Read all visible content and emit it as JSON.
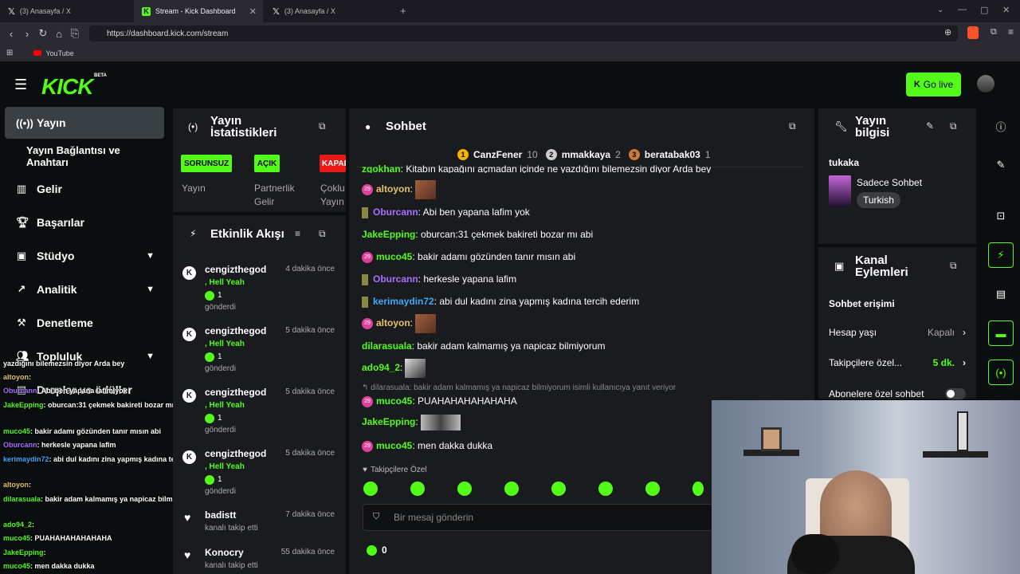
{
  "browser": {
    "tabs": [
      {
        "label": "(3) Anasayfa / X"
      },
      {
        "label": "Stream - Kick Dashboard"
      },
      {
        "label": "(3) Anasayfa / X"
      }
    ],
    "url": "https://dashboard.kick.com/stream",
    "bookmark": "YouTube"
  },
  "header": {
    "logo": "KICK",
    "beta": "BETA",
    "go_live": "Go live"
  },
  "sidebar": {
    "items": [
      {
        "label": "Yayın"
      },
      {
        "label": "Yayın Bağlantısı ve Anahtarı"
      },
      {
        "label": "Gelir"
      },
      {
        "label": "Başarılar"
      },
      {
        "label": "Stüdyo"
      },
      {
        "label": "Analitik"
      },
      {
        "label": "Denetleme"
      },
      {
        "label": "Topluluk"
      },
      {
        "label": "Droplar ve ödüller"
      }
    ]
  },
  "overlay": {
    "lines": [
      {
        "user": "",
        "text": "yazdığını bilemezsin diyor Arda bey"
      },
      {
        "user": "altoyon",
        "text": ": "
      },
      {
        "user": "Oburcann",
        "text": ": Abi ben yapana lafim yok"
      },
      {
        "user": "JakeEpping",
        "text": ": oburcan:31 çekmek bakireti bozar mı abi"
      },
      {
        "user": "muco45",
        "text": ": bakir adamı gözünden tanır mısın abi"
      },
      {
        "user": "Oburcann",
        "text": ": herkesle yapana lafim"
      },
      {
        "user": "kerimaydin72",
        "text": ": abi dul kadını zina yapmış kadına tercih ederim"
      },
      {
        "user": "altoyon",
        "text": ": "
      },
      {
        "user": "dilarasuala",
        "text": ": bakir adam kalmamış ya napicaz bilmiyorum"
      },
      {
        "user": "ado94_2",
        "text": ": "
      },
      {
        "user": "muco45",
        "text": ": PUAHAHAHAHAHAHA"
      },
      {
        "user": "JakeEpping",
        "text": ": "
      },
      {
        "user": "muco45",
        "text": ": men dakka dukka"
      }
    ]
  },
  "stats": {
    "title": "Yayın İstatistikleri",
    "badges": [
      {
        "label": "SORUNSUZ",
        "color": "#53fc18"
      },
      {
        "label": "AÇIK",
        "color": "#53fc18"
      },
      {
        "label": "KAPALI",
        "color": "#e91916"
      }
    ],
    "labels": [
      "Yayın",
      "Partnerlik Gelir",
      "Çoklu Yayın"
    ]
  },
  "events": {
    "title": "Etkinlik Akışı",
    "items": [
      {
        "user": "cengizthegod",
        "time": "4 dakika önce",
        "msg": ", Hell Yeah",
        "count": "1",
        "sub": "gönderdi"
      },
      {
        "user": "cengizthegod",
        "time": "5 dakika önce",
        "msg": ", Hell Yeah",
        "count": "1",
        "sub": "gönderdi"
      },
      {
        "user": "cengizthegod",
        "time": "5 dakika önce",
        "msg": ", Hell Yeah",
        "count": "1",
        "sub": "gönderdi"
      },
      {
        "user": "cengizthegod",
        "time": "5 dakika önce",
        "msg": ", Hell Yeah",
        "count": "1",
        "sub": "gönderdi"
      },
      {
        "user": "badistt",
        "time": "7 dakika önce",
        "msg": "",
        "count": "",
        "sub": "kanalı takip etti"
      },
      {
        "user": "Konocry",
        "time": "55 dakika önce",
        "msg": "",
        "count": "",
        "sub": "kanalı takip etti"
      }
    ]
  },
  "chat": {
    "title": "Sohbet",
    "leaders": [
      {
        "rank": "1",
        "name": "CanzFener",
        "count": "10"
      },
      {
        "rank": "2",
        "name": "mmakkaya",
        "count": "2"
      },
      {
        "rank": "3",
        "name": "beratabak03",
        "count": "1"
      }
    ],
    "messages": [
      {
        "user": "zgokhan",
        "color": "#53fc18",
        "text": ": Kitabın kapağını açmadan içinde ne yazdığını bilemezsin diyor Arda bey",
        "badge": "",
        "pic": false
      },
      {
        "user": "altoyon",
        "color": "#e6c466",
        "text": ":",
        "badge": "29",
        "pic": true
      },
      {
        "user": "Oburcann",
        "color": "#a970ff",
        "text": ": Abi ben yapana lafim yok",
        "badge": "",
        "pic": false
      },
      {
        "user": "JakeEpping",
        "color": "#53fc18",
        "text": ": oburcan:31 çekmek bakireti bozar mı abi",
        "badge": "",
        "pic": false
      },
      {
        "user": "muco45",
        "color": "#53fc18",
        "text": ": bakir adamı gözünden tanır mısın abi",
        "badge": "29",
        "pic": false
      },
      {
        "user": "Oburcann",
        "color": "#a970ff",
        "text": ": herkesle yapana lafim",
        "badge": "",
        "pic": false
      },
      {
        "user": "kerimaydin72",
        "color": "#3fa9f5",
        "text": ": abi dul kadını zina yapmış kadına tercih ederim",
        "badge": "",
        "pic": false
      },
      {
        "user": "altoyon",
        "color": "#e6c466",
        "text": ":",
        "badge": "29",
        "pic": true
      },
      {
        "user": "dilarasuala",
        "color": "#53fc18",
        "text": ": bakir adam kalmamış ya napicaz bilmiyorum",
        "badge": "",
        "pic": false
      },
      {
        "user": "ado94_2",
        "color": "#53fc18",
        "text": ":",
        "badge": "",
        "pic": true
      }
    ],
    "reply_ref": "dilarasuala: bakir adam kalmamış ya napicaz bilmiyorum isimli kullanıcıya yanıt veriyor",
    "messages2": [
      {
        "user": "muco45",
        "color": "#53fc18",
        "text": ": PUAHAHAHAHAHAHA",
        "badge": "29",
        "pic": false
      },
      {
        "user": "JakeEpping",
        "color": "#53fc18",
        "text": ":",
        "badge": "",
        "pic": true
      },
      {
        "user": "muco45",
        "color": "#53fc18",
        "text": ": men dakka dukka",
        "badge": "29",
        "pic": false
      }
    ],
    "followers_only": "Takipçilere Özel",
    "input_placeholder": "Bir mesaj gönderin",
    "kick_count": "0"
  },
  "info": {
    "title": "Yayın bilgisi",
    "username": "tukaka",
    "category": "Sadece Sohbet",
    "language": "Turkish"
  },
  "actions": {
    "title": "Kanal Eylemleri",
    "section": "Sohbet erişimi",
    "rows": [
      {
        "label": "Hesap yaşı",
        "value": "Kapalı"
      },
      {
        "label": "Takipçilere özel...",
        "value": "5 dk."
      },
      {
        "label": "Abonelere özel sohbet",
        "value": ""
      }
    ]
  }
}
